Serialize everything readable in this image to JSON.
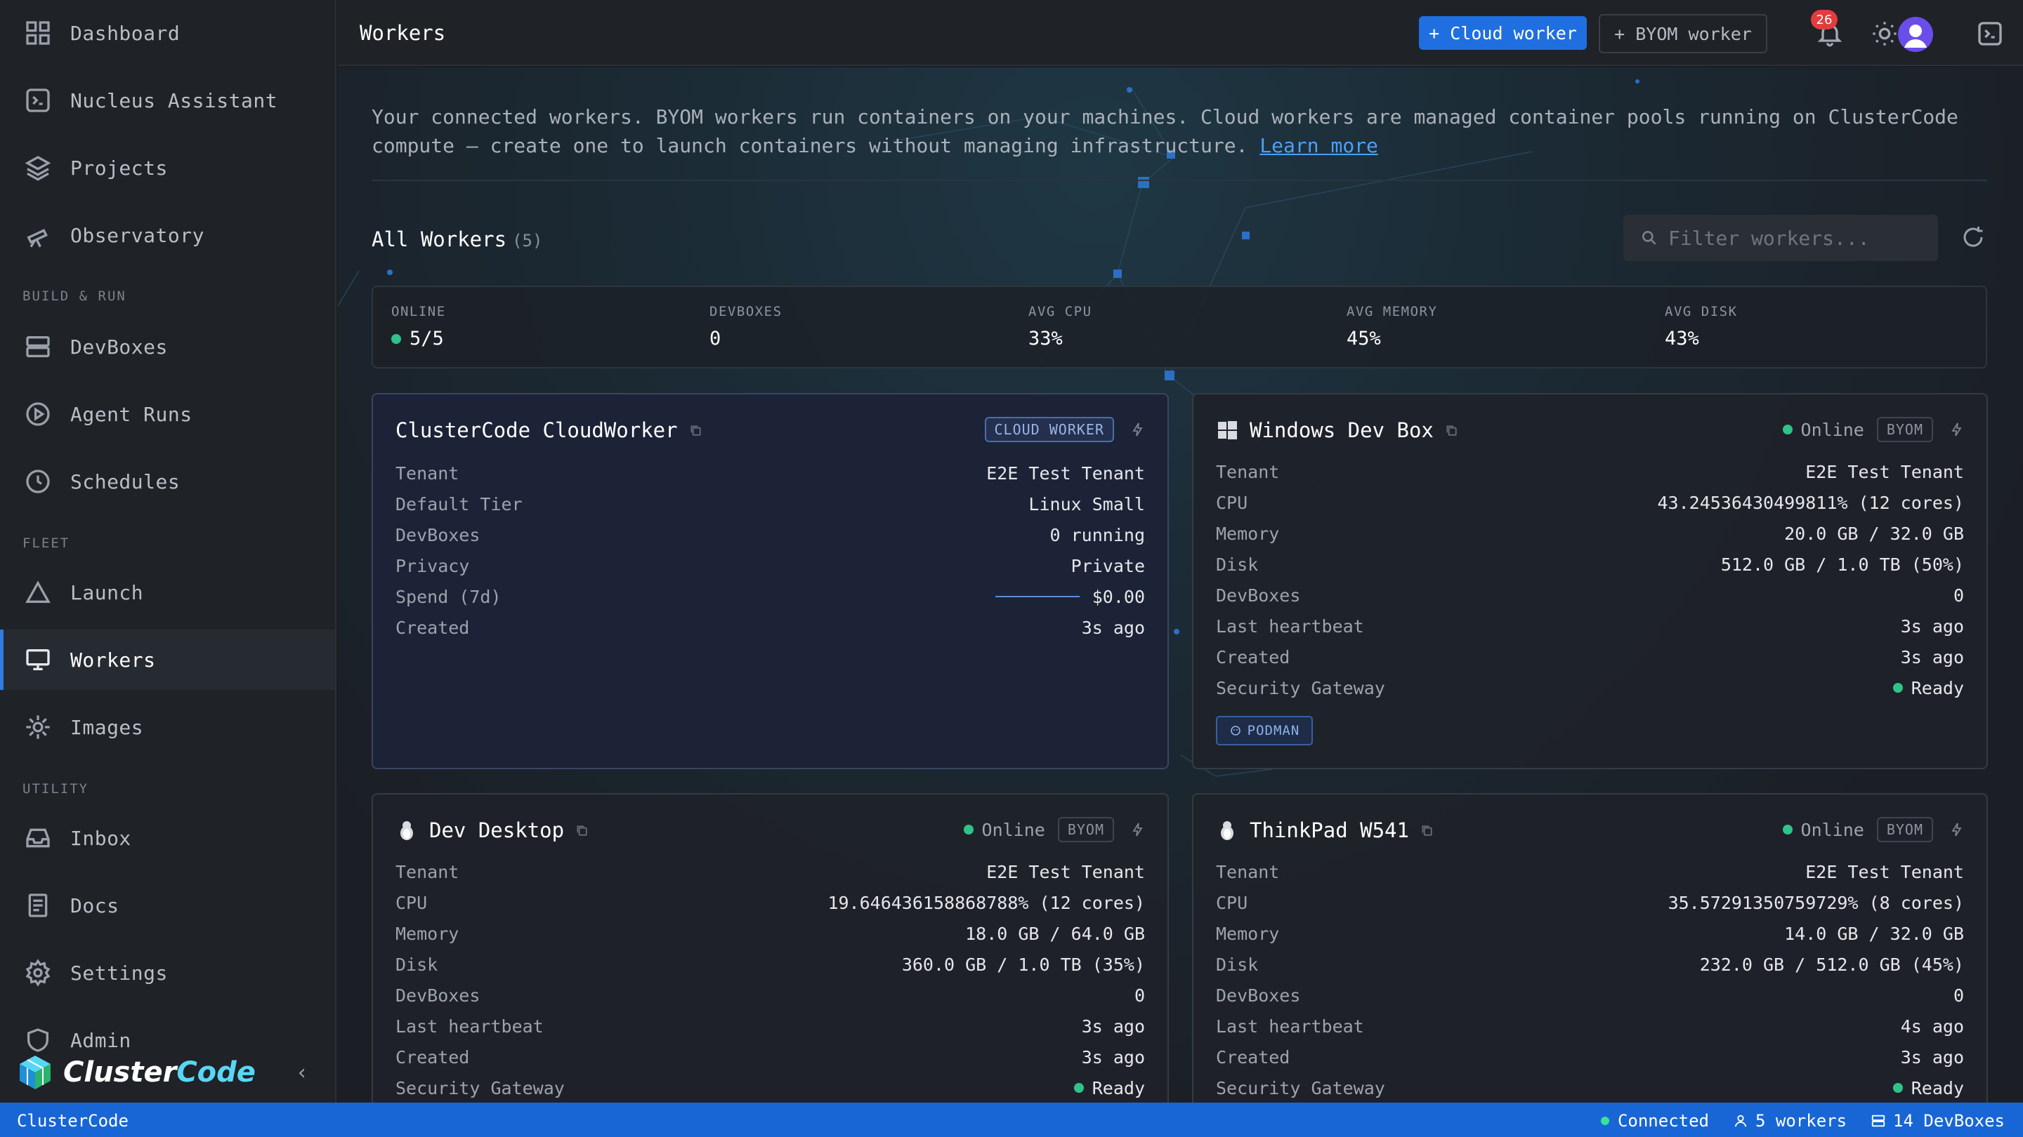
{
  "sidebar": {
    "items": [
      {
        "label": "Dashboard",
        "icon": "grid-icon"
      },
      {
        "label": "Nucleus Assistant",
        "icon": "assistant-icon"
      },
      {
        "label": "Projects",
        "icon": "layers-icon"
      },
      {
        "label": "Observatory",
        "icon": "telescope-icon"
      },
      {
        "label": "DevBoxes",
        "icon": "server-icon"
      },
      {
        "label": "Agent Runs",
        "icon": "play-circle-icon"
      },
      {
        "label": "Schedules",
        "icon": "clock-icon"
      },
      {
        "label": "Launch",
        "icon": "triangle-icon"
      },
      {
        "label": "Workers",
        "icon": "monitor-icon"
      },
      {
        "label": "Images",
        "icon": "gear-icon"
      },
      {
        "label": "Inbox",
        "icon": "inbox-icon"
      },
      {
        "label": "Docs",
        "icon": "document-icon"
      },
      {
        "label": "Settings",
        "icon": "settings-icon"
      },
      {
        "label": "Admin",
        "icon": "shield-icon"
      }
    ],
    "sections": [
      "BUILD & RUN",
      "FLEET",
      "UTILITY"
    ],
    "brand_a": "Cluster",
    "brand_b": "Code",
    "active": "Workers"
  },
  "header": {
    "title": "Workers",
    "cloud_button": "+ Cloud worker",
    "byom_button": "+ BYOM worker",
    "notification_count": "26"
  },
  "intro": {
    "text": "Your connected workers. BYOM workers run containers on your machines. Cloud workers are managed container pools running on ClusterCode compute — create one to launch containers without managing infrastructure.",
    "link": "Learn more"
  },
  "workers_header": {
    "title": "All Workers",
    "count": "(5)",
    "filter_placeholder": "Filter workers..."
  },
  "stats": [
    {
      "label": "ONLINE",
      "value": "5/5"
    },
    {
      "label": "DEVBOXES",
      "value": "0"
    },
    {
      "label": "AVG CPU",
      "value": "33%"
    },
    {
      "label": "AVG MEMORY",
      "value": "45%"
    },
    {
      "label": "AVG DISK",
      "value": "43%"
    }
  ],
  "cards": [
    {
      "name": "ClusterCode CloudWorker",
      "badge": "CLOUD WORKER",
      "rows": [
        {
          "k": "Tenant",
          "v": "E2E Test Tenant"
        },
        {
          "k": "Default Tier",
          "v": "Linux Small"
        },
        {
          "k": "DevBoxes",
          "v": "0 running"
        },
        {
          "k": "Privacy",
          "v": "Private"
        },
        {
          "k": "Spend (7d)",
          "v": "$0.00"
        },
        {
          "k": "Created",
          "v": "3s ago"
        }
      ]
    },
    {
      "name": "Windows Dev Box",
      "status": "Online",
      "badge": "BYOM",
      "runtime": "PODMAN",
      "rows": [
        {
          "k": "Tenant",
          "v": "E2E Test Tenant"
        },
        {
          "k": "CPU",
          "v": "43.24536430499811% (12 cores)"
        },
        {
          "k": "Memory",
          "v": "20.0 GB / 32.0 GB"
        },
        {
          "k": "Disk",
          "v": "512.0 GB / 1.0 TB (50%)"
        },
        {
          "k": "DevBoxes",
          "v": "0"
        },
        {
          "k": "Last heartbeat",
          "v": "3s ago"
        },
        {
          "k": "Created",
          "v": "3s ago"
        },
        {
          "k": "Security Gateway",
          "v": "Ready"
        }
      ]
    },
    {
      "name": "Dev Desktop",
      "status": "Online",
      "badge": "BYOM",
      "rows": [
        {
          "k": "Tenant",
          "v": "E2E Test Tenant"
        },
        {
          "k": "CPU",
          "v": "19.646436158868788% (12 cores)"
        },
        {
          "k": "Memory",
          "v": "18.0 GB / 64.0 GB"
        },
        {
          "k": "Disk",
          "v": "360.0 GB / 1.0 TB (35%)"
        },
        {
          "k": "DevBoxes",
          "v": "0"
        },
        {
          "k": "Last heartbeat",
          "v": "3s ago"
        },
        {
          "k": "Created",
          "v": "3s ago"
        },
        {
          "k": "Security Gateway",
          "v": "Ready"
        }
      ]
    },
    {
      "name": "ThinkPad W541",
      "status": "Online",
      "badge": "BYOM",
      "rows": [
        {
          "k": "Tenant",
          "v": "E2E Test Tenant"
        },
        {
          "k": "CPU",
          "v": "35.57291350759729% (8 cores)"
        },
        {
          "k": "Memory",
          "v": "14.0 GB / 32.0 GB"
        },
        {
          "k": "Disk",
          "v": "232.0 GB / 512.0 GB (45%)"
        },
        {
          "k": "DevBoxes",
          "v": "0"
        },
        {
          "k": "Last heartbeat",
          "v": "4s ago"
        },
        {
          "k": "Created",
          "v": "3s ago"
        },
        {
          "k": "Security Gateway",
          "v": "Ready"
        }
      ]
    }
  ],
  "statusbar": {
    "left": "ClusterCode",
    "connected": "Connected",
    "workers": "5 workers",
    "devboxes": "14 DevBoxes"
  },
  "colors": {
    "accent": "#1f6fe0",
    "online": "#2fc38a",
    "statusbar": "#1866d6",
    "badge": "#e23c3c"
  }
}
